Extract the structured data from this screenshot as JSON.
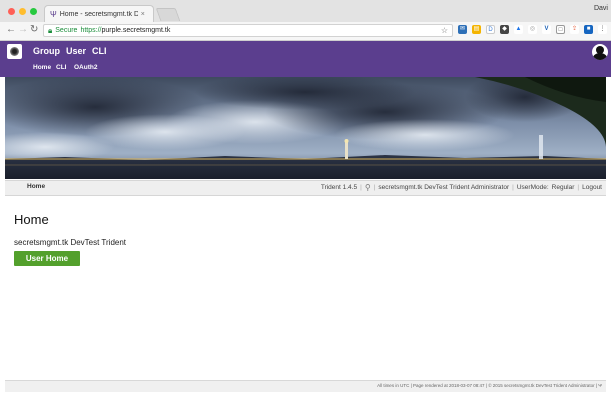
{
  "browser": {
    "tab_title": "Home - secretsmgmt.tk DevT",
    "profile_name": "Davi",
    "secure_label": "Secure",
    "url_scheme": "https://",
    "url_host": "purple.secretsmgmt.tk",
    "colors": {
      "traffic_red": "#ff5f56",
      "traffic_yellow": "#ffbd2e",
      "traffic_green": "#27c93f"
    }
  },
  "header": {
    "top_menu": [
      "Group",
      "User",
      "CLI"
    ],
    "sub_menu": [
      "Home",
      "CLI",
      "OAuth2"
    ],
    "colors": {
      "background": "#5b3e8e"
    }
  },
  "statusbar": {
    "breadcrumb": "Home",
    "version": "Trident 1.4.5",
    "user": "secretsmgmt.tk DevTest Trident Administrator",
    "usermode_label": "UserMode:",
    "usermode_value": "Regular",
    "logout": "Logout"
  },
  "main": {
    "title": "Home",
    "system_name": "secretsmgmt.tk DevTest Trident",
    "user_home_button": "User Home",
    "colors": {
      "button": "#53a02c"
    }
  },
  "footer": {
    "text": "All times in UTC | Page rendered at 2018-03-07 08:47 | © 2015 secretsmgmt.tk DevTest Trident Administrator | Ψ"
  }
}
